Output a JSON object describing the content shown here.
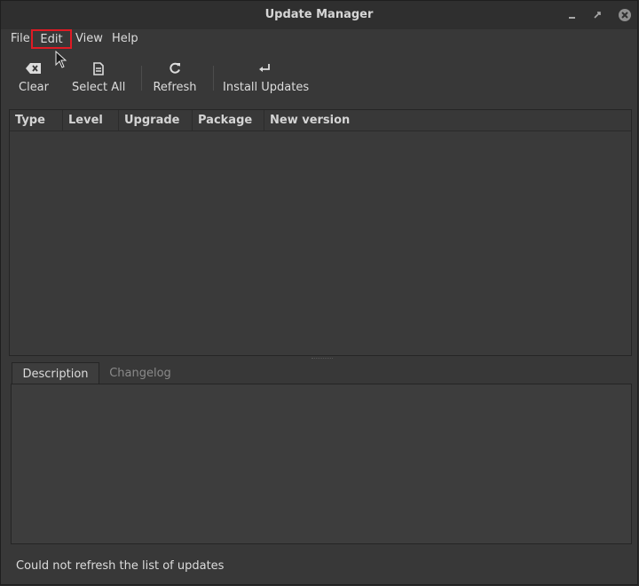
{
  "window": {
    "title": "Update Manager"
  },
  "menu": {
    "file": "File",
    "edit": "Edit",
    "view": "View",
    "help": "Help"
  },
  "toolbar": {
    "clear_label": "Clear",
    "select_all_label": "Select All",
    "refresh_label": "Refresh",
    "install_label": "Install Updates"
  },
  "table": {
    "columns": [
      "Type",
      "Level",
      "Upgrade",
      "Package",
      "New version"
    ],
    "rows": []
  },
  "tabs": {
    "description": "Description",
    "changelog": "Changelog",
    "selected": "Description"
  },
  "status": {
    "text": "Could not refresh the list of updates"
  },
  "colors": {
    "highlight_box": "#e01b24",
    "close_button": "#8f8f8f",
    "background": "#383838"
  },
  "icons": {
    "clear": "backspace-icon",
    "select_all": "document-icon",
    "refresh": "refresh-icon",
    "install": "return-arrow-icon"
  }
}
